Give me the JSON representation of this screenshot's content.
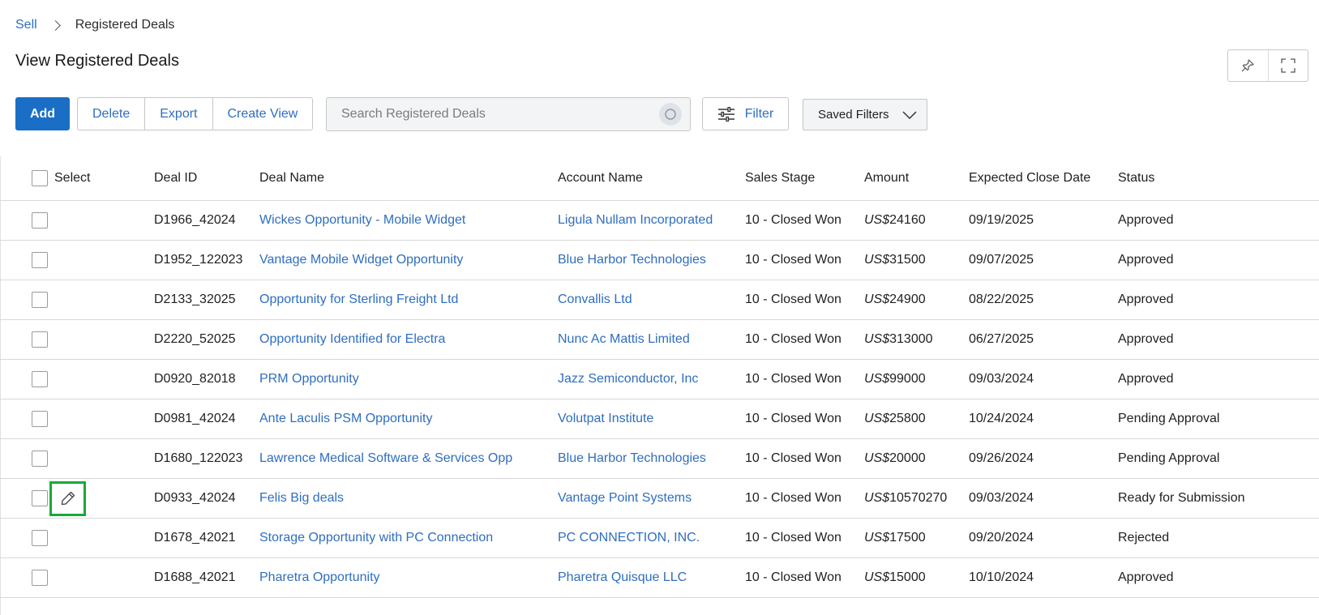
{
  "breadcrumb": {
    "parent": "Sell",
    "current": "Registered Deals"
  },
  "page": {
    "title": "View Registered Deals"
  },
  "toolbar": {
    "add_label": "Add",
    "delete_label": "Delete",
    "export_label": "Export",
    "create_view_label": "Create View",
    "filter_label": "Filter",
    "saved_filters_label": "Saved Filters"
  },
  "search": {
    "placeholder": "Search Registered Deals"
  },
  "icons": {
    "pin": "pin-icon",
    "fullscreen": "expand-icon",
    "search": "search-icon",
    "filter": "sliders-icon",
    "dropdown": "chevron-down-icon",
    "edit": "pencil-icon"
  },
  "colors": {
    "accent": "#1a6ec6",
    "link": "#2f6ebf",
    "highlight": "#19a83a"
  },
  "table": {
    "headers": {
      "select": "Select",
      "deal_id": "Deal ID",
      "deal_name": "Deal Name",
      "account_name": "Account Name",
      "sales_stage": "Sales Stage",
      "amount": "Amount",
      "close_date": "Expected Close Date",
      "status": "Status"
    },
    "currency": "US$",
    "rows": [
      {
        "deal_id": "D1966_42024",
        "deal_name": "Wickes Opportunity - Mobile Widget",
        "account_name": "Ligula Nullam Incorporated",
        "sales_stage": "10 - Closed Won",
        "amount": "24160",
        "close_date": "09/19/2025",
        "status": "Approved"
      },
      {
        "deal_id": "D1952_122023",
        "deal_name": "Vantage Mobile Widget Opportunity",
        "account_name": "Blue Harbor Technologies",
        "sales_stage": "10 - Closed Won",
        "amount": "31500",
        "close_date": "09/07/2025",
        "status": "Approved"
      },
      {
        "deal_id": "D2133_32025",
        "deal_name": "Opportunity for Sterling Freight Ltd",
        "account_name": "Convallis Ltd",
        "sales_stage": "10 - Closed Won",
        "amount": "24900",
        "close_date": "08/22/2025",
        "status": "Approved"
      },
      {
        "deal_id": "D2220_52025",
        "deal_name": "Opportunity Identified for Electra",
        "account_name": "Nunc Ac Mattis Limited",
        "sales_stage": "10 - Closed Won",
        "amount": "313000",
        "close_date": "06/27/2025",
        "status": "Approved"
      },
      {
        "deal_id": "D0920_82018",
        "deal_name": "PRM Opportunity",
        "account_name": "Jazz Semiconductor, Inc",
        "sales_stage": "10 - Closed Won",
        "amount": "99000",
        "close_date": "09/03/2024",
        "status": "Approved"
      },
      {
        "deal_id": "D0981_42024",
        "deal_name": "Ante Laculis PSM Opportunity",
        "account_name": "Volutpat Institute",
        "sales_stage": "10 - Closed Won",
        "amount": "25800",
        "close_date": "10/24/2024",
        "status": "Pending Approval"
      },
      {
        "deal_id": "D1680_122023",
        "deal_name": "Lawrence Medical Software & Services Opp",
        "account_name": "Blue Harbor Technologies",
        "sales_stage": "10 - Closed Won",
        "amount": "20000",
        "close_date": "09/26/2024",
        "status": "Pending Approval"
      },
      {
        "deal_id": "D0933_42024",
        "deal_name": "Felis Big deals",
        "account_name": "Vantage Point Systems",
        "sales_stage": "10 - Closed Won",
        "amount": "10570270",
        "close_date": "09/03/2024",
        "status": "Ready for Submission"
      },
      {
        "deal_id": "D1678_42021",
        "deal_name": "Storage Opportunity with PC Connection",
        "account_name": "PC CONNECTION, INC.",
        "sales_stage": "10 - Closed Won",
        "amount": "17500",
        "close_date": "09/20/2024",
        "status": "Rejected"
      },
      {
        "deal_id": "D1688_42021",
        "deal_name": "Pharetra Opportunity",
        "account_name": "Pharetra Quisque LLC",
        "sales_stage": "10 - Closed Won",
        "amount": "15000",
        "close_date": "10/10/2024",
        "status": "Approved"
      }
    ]
  }
}
